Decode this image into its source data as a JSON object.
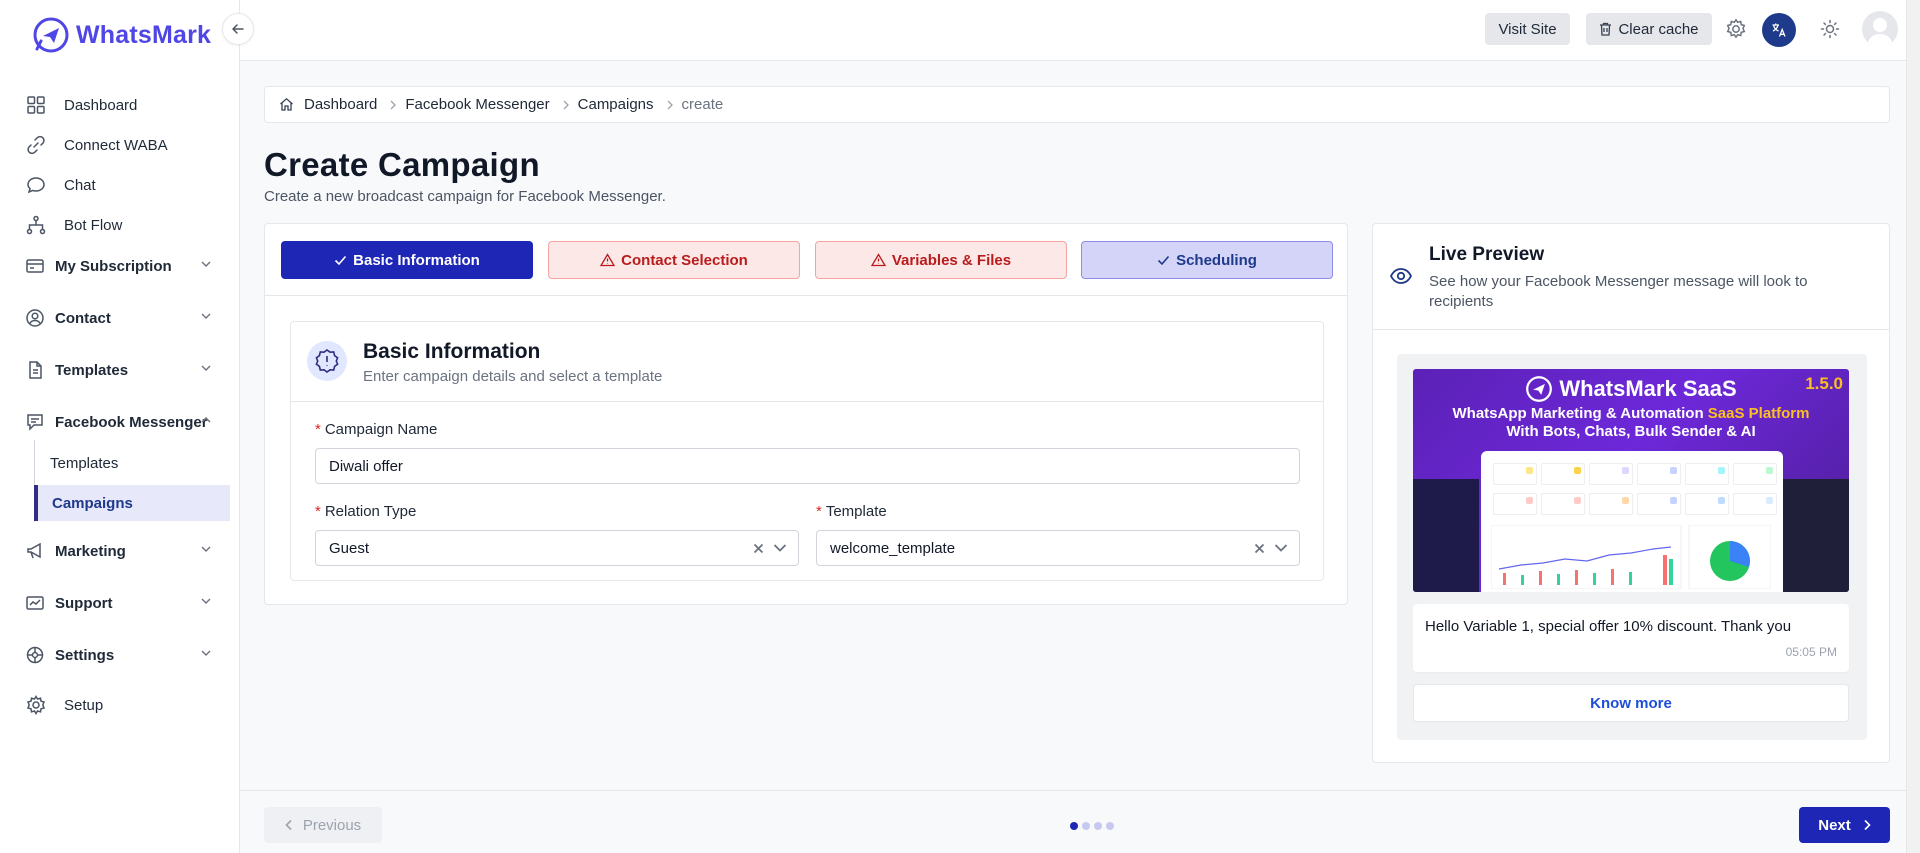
{
  "app": {
    "name": "WhatsMark"
  },
  "topbar": {
    "visit_site": "Visit Site",
    "clear_cache": "Clear cache"
  },
  "sidebar": {
    "items": [
      {
        "label": "Dashboard",
        "icon": "grid-icon"
      },
      {
        "label": "Connect WABA",
        "icon": "link-icon"
      },
      {
        "label": "Chat",
        "icon": "chat-bubble-icon"
      },
      {
        "label": "Bot Flow",
        "icon": "flow-icon"
      },
      {
        "label": "My Subscription",
        "icon": "credit-card-icon"
      },
      {
        "label": "Contact",
        "icon": "user-circle-icon"
      },
      {
        "label": "Templates",
        "icon": "document-icon"
      },
      {
        "label": "Facebook Messenger",
        "icon": "messenger-icon"
      },
      {
        "label": "Marketing",
        "icon": "megaphone-icon"
      },
      {
        "label": "Support",
        "icon": "ticket-icon"
      },
      {
        "label": "Settings",
        "icon": "gear-icon"
      },
      {
        "label": "Setup",
        "icon": "cog-icon"
      }
    ],
    "sub_items": [
      {
        "label": "Templates"
      },
      {
        "label": "Campaigns"
      }
    ]
  },
  "breadcrumb": [
    "Dashboard",
    "Facebook Messenger",
    "Campaigns",
    "create"
  ],
  "page": {
    "title": "Create Campaign",
    "subtitle": "Create a new broadcast campaign for Facebook Messenger."
  },
  "steps": [
    {
      "label": "Basic Information",
      "state": "done"
    },
    {
      "label": "Contact Selection",
      "state": "warning"
    },
    {
      "label": "Variables & Files",
      "state": "warning"
    },
    {
      "label": "Scheduling",
      "state": "done-light"
    }
  ],
  "form": {
    "section_title": "Basic Information",
    "section_subtitle": "Enter campaign details and select a template",
    "campaign_name_label": "Campaign Name",
    "campaign_name_value": "Diwali offer",
    "relation_type_label": "Relation Type",
    "relation_type_value": "Guest",
    "template_label": "Template",
    "template_value": "welcome_template",
    "required_mark": "*"
  },
  "preview": {
    "title": "Live Preview",
    "subtitle": "See how your Facebook Messenger message will look to recipients",
    "banner": {
      "brand": "WhatsMark SaaS",
      "version": "1.5.0",
      "line1_a": "WhatsApp Marketing & Automation ",
      "line1_b": "SaaS Platform",
      "line2": "With Bots, Chats, Bulk Sender & AI"
    },
    "message": "Hello Variable 1, special offer 10% discount. Thank you",
    "time": "05:05 PM",
    "button": "Know more"
  },
  "footer": {
    "previous": "Previous",
    "next": "Next",
    "steps_total": 4,
    "current_step": 1
  },
  "colors": {
    "primary": "#1e27b5",
    "brand": "#4f46e5",
    "warning_bg": "#fde8e8",
    "warning_text": "#b91c1c"
  }
}
